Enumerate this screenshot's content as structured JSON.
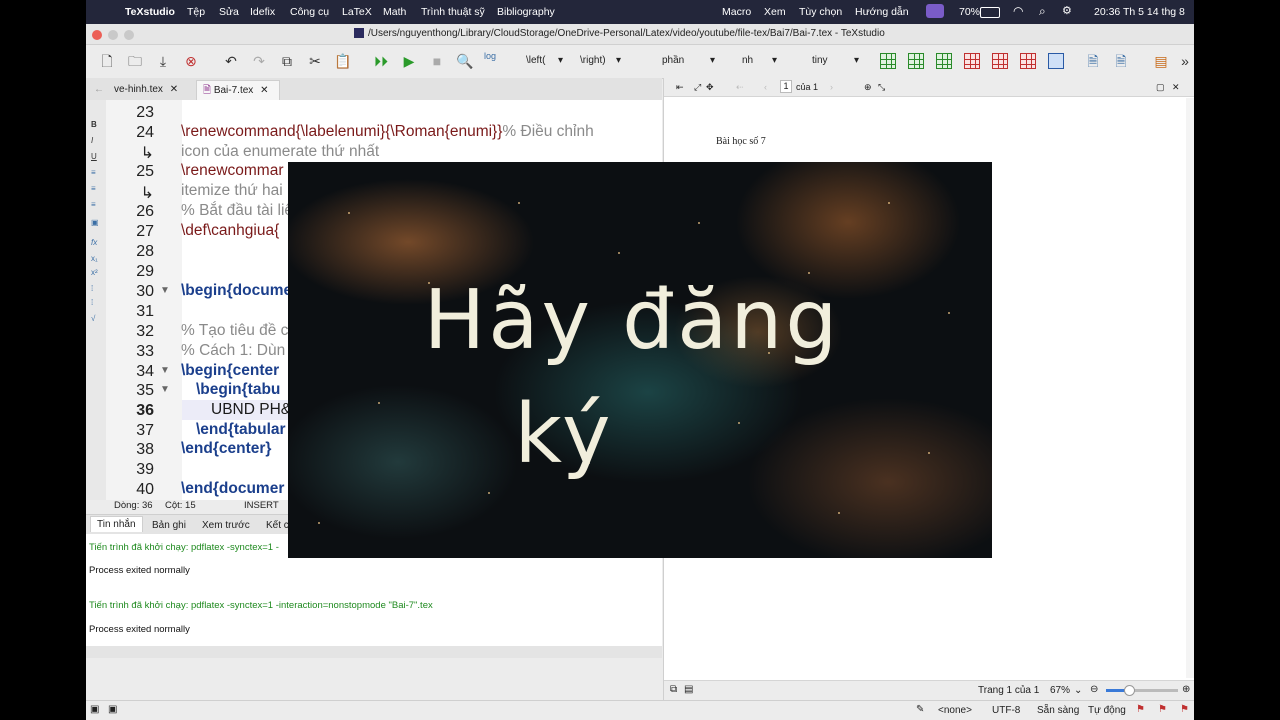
{
  "menubar": {
    "app": "TeXstudio",
    "items": [
      "Tệp",
      "Sửa",
      "Idefix",
      "Công cụ",
      "LaTeX",
      "Math",
      "Trình thuật sỹ",
      "Bibliography"
    ],
    "right_items": [
      "Macro",
      "Xem",
      "Tùy chọn",
      "Hướng dẫn"
    ],
    "battery": "70%",
    "clock": "20:36 Th 5 14 thg 8"
  },
  "window_title": "/Users/nguyenthong/Library/CloudStorage/OneDrive-Personal/Latex/video/youtube/file-tex/Bai7/Bai-7.tex - TeXstudio",
  "toolbar": {
    "left_label": "\\left(",
    "right_label": "\\right)",
    "section_label": "phần",
    "ref_label": "nh",
    "size_label": "tiny",
    "log_label": "log"
  },
  "tabs": [
    {
      "label": "ve-hinh.tex"
    },
    {
      "label": "Bai-7.tex"
    }
  ],
  "editor": {
    "lines": [
      {
        "num": "23",
        "text": ""
      },
      {
        "num": "24",
        "cmd": "\\renewcommand{\\labelenumi}{\\Roman{enumi}}",
        "comment": "% Điều chỉnh"
      },
      {
        "num": "↳",
        "comment": "icon của enumerate thứ nhất"
      },
      {
        "num": "25",
        "cmd": "\\renewcommar"
      },
      {
        "num": "↳",
        "comment": "itemize thứ hai"
      },
      {
        "num": "26",
        "comment": "% Bắt đầu tài liệ"
      },
      {
        "num": "27",
        "cmd": "\\def\\canhgiua{"
      },
      {
        "num": "28",
        "text": ""
      },
      {
        "num": "29",
        "text": ""
      },
      {
        "num": "30",
        "kw": "\\begin{docume"
      },
      {
        "num": "31",
        "text": ""
      },
      {
        "num": "32",
        "comment": "% Tạo tiêu đề c"
      },
      {
        "num": "33",
        "comment": "% Cách 1: Dùn"
      },
      {
        "num": "34",
        "kw": "\\begin{center"
      },
      {
        "num": "35",
        "kw": "\\begin{tabu"
      },
      {
        "num": "36",
        "text": "UBND PH&"
      },
      {
        "num": "37",
        "kw": "\\end{tabular"
      },
      {
        "num": "38",
        "kw": "\\end{center}"
      },
      {
        "num": "39",
        "text": ""
      },
      {
        "num": "40",
        "kw": "\\end{documer"
      }
    ]
  },
  "status": {
    "line": "Dòng: 36",
    "col": "Cột: 15",
    "mode": "INSERT"
  },
  "message_tabs": [
    "Tin nhắn",
    "Bản ghi",
    "Xem trước",
    "Kết c"
  ],
  "messages": [
    {
      "text": "Tiến trình đã khởi chạy: pdflatex -synctex=1 -",
      "color": "#1f8a1f"
    },
    {
      "text": "Process exited normally",
      "color": "#111111"
    },
    {
      "text": "Tiến trình đã khởi chạy: pdflatex -synctex=1 -interaction=nonstopmode \"Bai-7\".tex",
      "color": "#1f8a1f"
    },
    {
      "text": "Process exited normally",
      "color": "#111111"
    }
  ],
  "pdf": {
    "page_input": "1",
    "page_of": "của 1",
    "doc_text": "Bài học số 7",
    "page_status": "Trang 1 của 1",
    "zoom": "67%"
  },
  "bottombar": {
    "none": "<none>",
    "encoding": "UTF-8",
    "ready": "Sẵn sàng",
    "auto": "Tự động"
  },
  "overlay": {
    "line1": "Hãy đăng",
    "line2": "ký"
  },
  "colors": {
    "menubar": "#23263a",
    "keyword": "#1b3f8c",
    "command": "#7a1a1a",
    "comment": "#8a8a8a",
    "success": "#1f8a1f"
  }
}
